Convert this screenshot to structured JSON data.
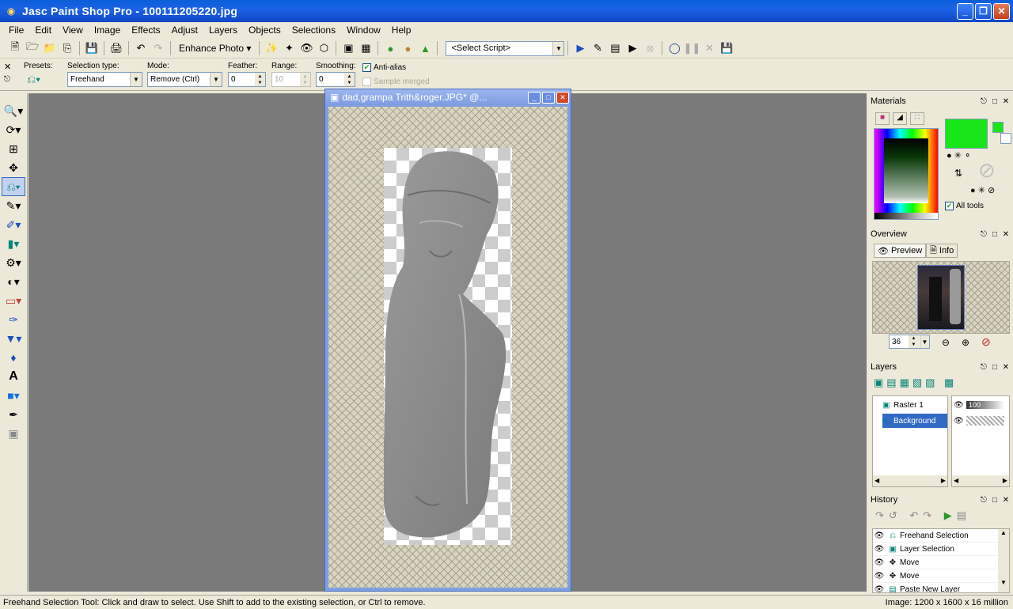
{
  "window": {
    "title": "Jasc Paint Shop Pro - 100111205220.jpg"
  },
  "menu": [
    "File",
    "Edit",
    "View",
    "Image",
    "Effects",
    "Adjust",
    "Layers",
    "Objects",
    "Selections",
    "Window",
    "Help"
  ],
  "toolbar": {
    "enhance_label": "Enhance Photo",
    "script_select": "<Select Script>"
  },
  "tool_options": {
    "presets_label": "Presets:",
    "selection_type_label": "Selection type:",
    "selection_type_value": "Freehand",
    "mode_label": "Mode:",
    "mode_value": "Remove (Ctrl)",
    "feather_label": "Feather:",
    "feather_value": "0",
    "range_label": "Range:",
    "range_value": "10",
    "smoothing_label": "Smoothing:",
    "smoothing_value": "0",
    "antialias_label": "Anti-alias",
    "antialias_checked": true,
    "sample_merged_label": "Sample merged",
    "sample_merged_checked": false
  },
  "document": {
    "title": "dad,grampa Trith&roger.JPG* @..."
  },
  "materials": {
    "title": "Materials",
    "foreground_color": "#19e619",
    "background_color": "#ffffff",
    "all_tools_label": "All tools",
    "all_tools_checked": true
  },
  "overview": {
    "title": "Overview",
    "tab_preview": "Preview",
    "tab_info": "Info",
    "zoom_value": "36"
  },
  "layers": {
    "title": "Layers",
    "items": [
      {
        "name": "Raster 1",
        "opacity": "100",
        "selected": false
      },
      {
        "name": "Background",
        "opacity": "",
        "selected": true
      }
    ]
  },
  "history": {
    "title": "History",
    "items": [
      "Freehand Selection",
      "Layer Selection",
      "Move",
      "Move",
      "Paste New Layer"
    ]
  },
  "status": {
    "message": "Freehand Selection Tool: Click and draw to select. Use Shift to add to the existing selection, or Ctrl to remove.",
    "image_info": "Image:  1200 x 1600 x 16 million"
  }
}
